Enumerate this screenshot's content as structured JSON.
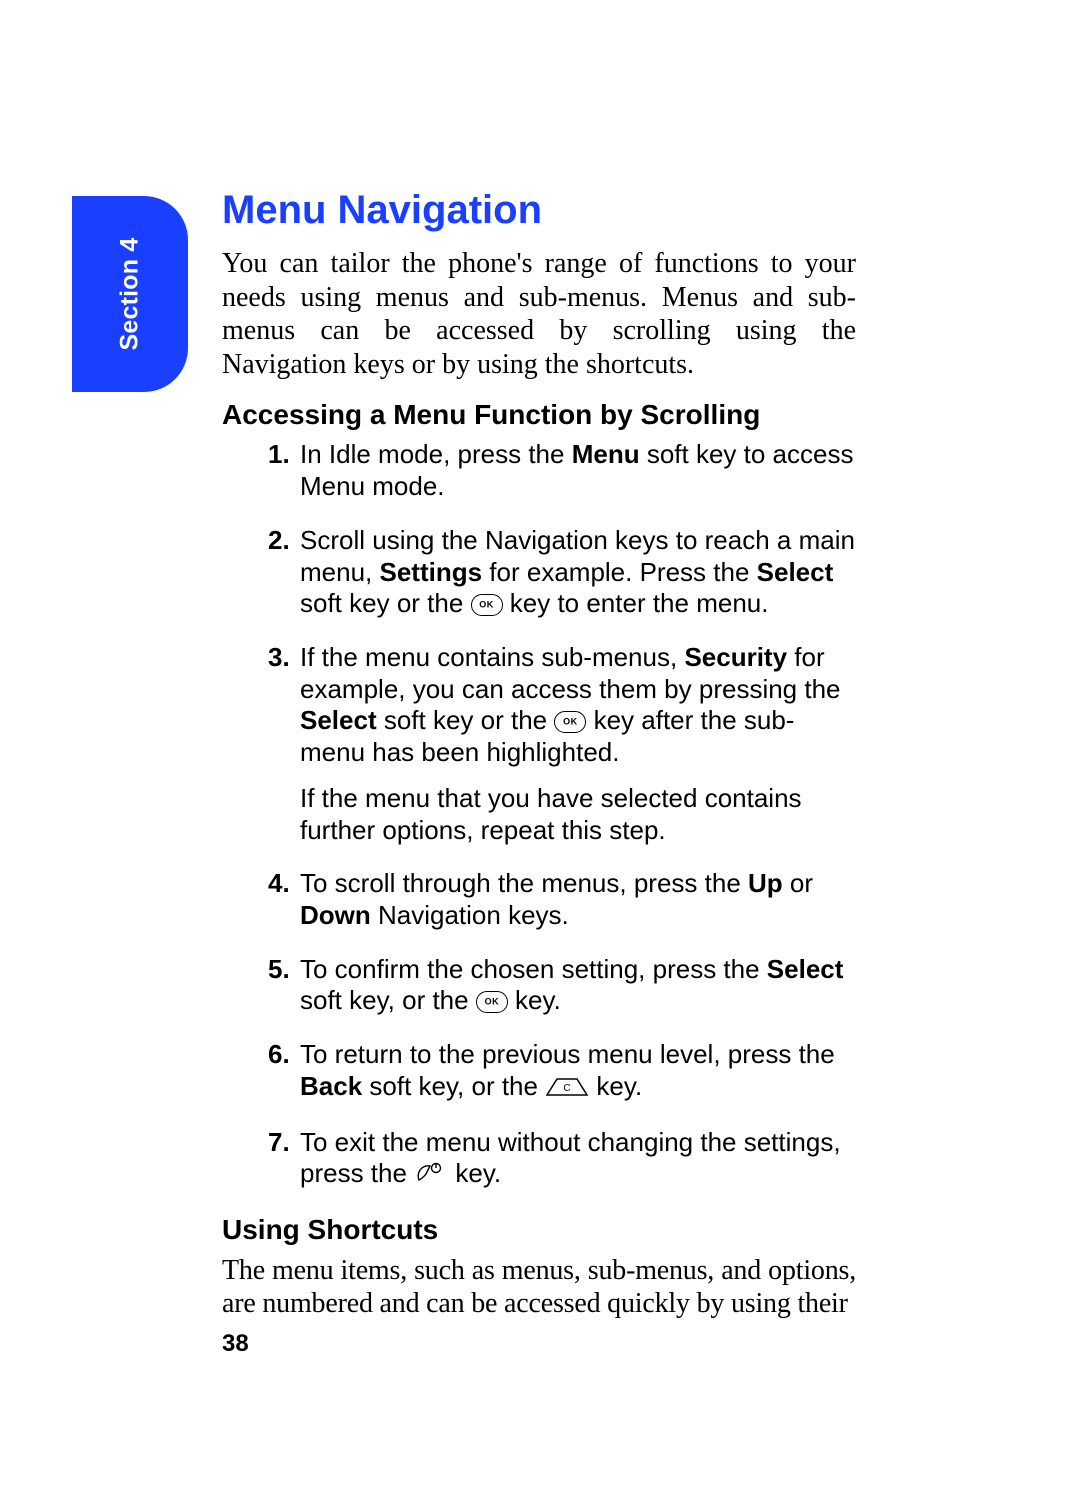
{
  "section_tab": "Section 4",
  "title": "Menu Navigation",
  "intro": "You can tailor the phone's range of functions to your needs using menus and sub-menus. Menus and sub-menus can be accessed by scrolling using the Navigation keys or by using the shortcuts.",
  "sub1": "Accessing a Menu Function by Scrolling",
  "steps": {
    "s1a": "In Idle mode, press the ",
    "s1b": "Menu",
    "s1c": " soft key to access Menu mode.",
    "s2a": "Scroll using the Navigation keys to reach a main menu, ",
    "s2b": "Settings",
    "s2c": " for example. Press the ",
    "s2d": "Select",
    "s2e": " soft key or the ",
    "s2f": " key to enter the menu.",
    "s3a": "If the menu contains sub-menus, ",
    "s3b": "Security",
    "s3c": " for example, you can access them by pressing the ",
    "s3d": "Select",
    "s3e": " soft key or the ",
    "s3f": " key after the sub-menu has been highlighted.",
    "s3g": "If the menu that you have selected contains further options, repeat this step.",
    "s4a": "To scroll through the menus, press the ",
    "s4b": "Up",
    "s4c": " or ",
    "s4d": "Down",
    "s4e": " Navigation keys.",
    "s5a": "To confirm the chosen setting, press the ",
    "s5b": "Select",
    "s5c": " soft key, or the ",
    "s5d": " key.",
    "s6a": "To return to the previous menu level, press the ",
    "s6b": "Back",
    "s6c": " soft key, or the ",
    "s6d": " key.",
    "s7a": "To exit the menu without changing the settings, press the ",
    "s7b": " key."
  },
  "sub2": "Using Shortcuts",
  "shortcuts_para": "The menu items, such as menus, sub-menus, and options, are numbered and can be accessed quickly by using their",
  "page_number": "38"
}
